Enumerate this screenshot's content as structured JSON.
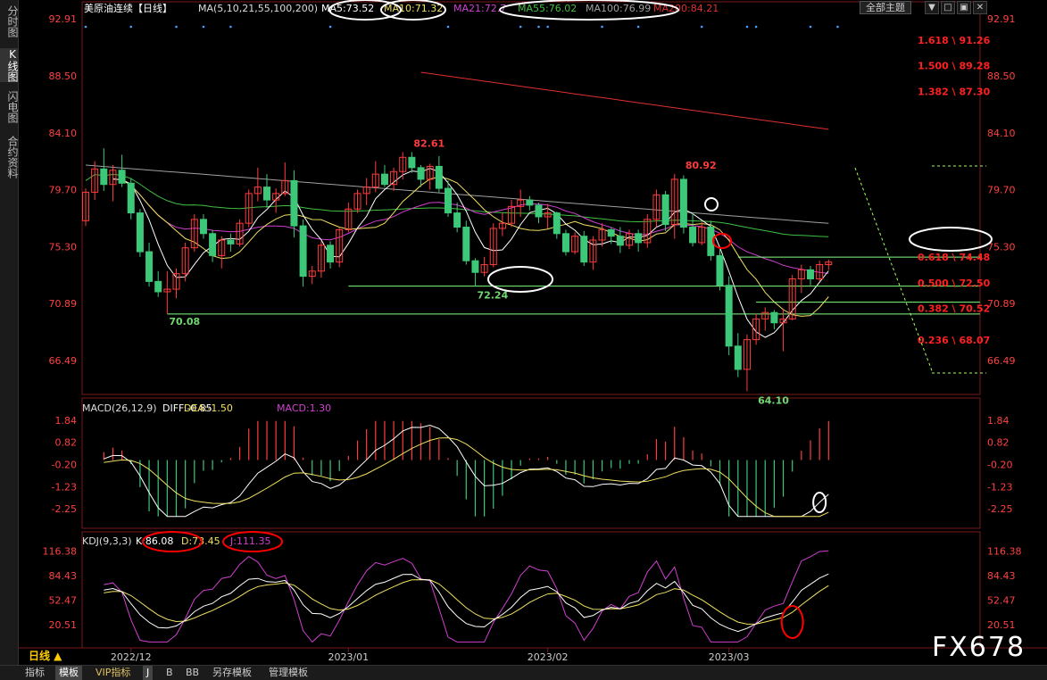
{
  "sidebar": {
    "tabs": [
      {
        "label": "分时图"
      },
      {
        "label": "K线图"
      },
      {
        "label": "闪电图"
      },
      {
        "label": "合约资料"
      }
    ]
  },
  "toolbar": {
    "theme_label": "全部主题",
    "period_label": "日线 ▲",
    "win_buttons": [
      "▼",
      "□",
      "▣",
      "✕"
    ]
  },
  "bottom_tabs": [
    {
      "label": "指标",
      "active": false
    },
    {
      "label": "模板",
      "active": true
    },
    {
      "label": "VIP指标",
      "active": false
    },
    {
      "label": "J",
      "active": false
    },
    {
      "label": "B",
      "active": false
    },
    {
      "label": "BB",
      "active": false
    },
    {
      "label": "另存模板",
      "active": false
    },
    {
      "label": "管理模板",
      "active": false
    }
  ],
  "watermark": "FX678",
  "colors": {
    "up": "#ff3c3c",
    "down": "#3cc878",
    "ma5": "#ffffff",
    "ma10": "#f0e060",
    "ma21": "#d040d0",
    "ma55": "#40c040",
    "ma100": "#a0a0a0",
    "ma200": "#e03030",
    "fib": "#ff2020",
    "support": "#80ff80",
    "axis": "#ff4040",
    "annot_white": "#ffffff",
    "annot_red": "#ff0000"
  },
  "chart_data": [
    {
      "type": "candlestick",
      "title": "美原油连续【日线】",
      "legend": {
        "ma_label": "MA(5,10,21,55,100,200)",
        "items": [
          {
            "name": "MA5",
            "text": "MA5:73.52",
            "color": "#ffffff"
          },
          {
            "name": "MA10",
            "text": "MA10:71.32",
            "color": "#f0e060"
          },
          {
            "name": "MA21",
            "text": "MA21:72.7",
            "color": "#d040d0"
          },
          {
            "name": "MA55",
            "text": "MA55:76.02",
            "color": "#40c040"
          },
          {
            "name": "MA100",
            "text": "MA100:76.99",
            "color": "#a0a0a0"
          },
          {
            "name": "MA200",
            "text": "MA200:84.21",
            "color": "#e03030"
          }
        ]
      },
      "y_ticks": [
        "92.91",
        "88.50",
        "84.10",
        "79.70",
        "75.30",
        "70.89",
        "66.49"
      ],
      "ylim": [
        64.0,
        93.4
      ],
      "x_ticks": [
        {
          "label": "2022/12",
          "index": 5
        },
        {
          "label": "2023/01",
          "index": 29
        },
        {
          "label": "2023/02",
          "index": 51
        },
        {
          "label": "2023/03",
          "index": 71
        }
      ],
      "candles": [
        [
          77.3,
          79.8,
          76.9,
          79.5
        ],
        [
          79.5,
          81.9,
          78.9,
          81.3
        ],
        [
          81.3,
          82.9,
          79.6,
          80.1
        ],
        [
          80.1,
          81.6,
          78.8,
          81.2
        ],
        [
          81.2,
          82.4,
          79.9,
          80.2
        ],
        [
          80.2,
          80.6,
          77.4,
          77.9
        ],
        [
          77.9,
          78.2,
          74.5,
          74.9
        ],
        [
          74.9,
          75.6,
          72.2,
          72.6
        ],
        [
          72.6,
          73.4,
          71.4,
          71.8
        ],
        [
          71.8,
          73.4,
          70.1,
          72.0
        ],
        [
          72.0,
          73.6,
          71.3,
          73.2
        ],
        [
          73.2,
          75.6,
          72.6,
          75.2
        ],
        [
          75.2,
          77.8,
          74.9,
          77.4
        ],
        [
          77.4,
          77.8,
          75.9,
          76.3
        ],
        [
          76.3,
          76.6,
          74.1,
          74.6
        ],
        [
          74.6,
          76.1,
          73.6,
          75.8
        ],
        [
          75.8,
          76.3,
          74.9,
          75.5
        ],
        [
          75.5,
          77.4,
          75.3,
          77.1
        ],
        [
          77.1,
          79.7,
          76.8,
          79.4
        ],
        [
          79.4,
          81.4,
          78.8,
          79.9
        ],
        [
          79.9,
          80.9,
          78.3,
          78.9
        ],
        [
          78.9,
          79.8,
          77.9,
          79.4
        ],
        [
          79.4,
          81.8,
          79.2,
          80.4
        ],
        [
          80.4,
          81.2,
          76.0,
          76.9
        ],
        [
          76.9,
          77.4,
          72.2,
          73.0
        ],
        [
          73.0,
          73.8,
          72.4,
          73.4
        ],
        [
          73.4,
          75.7,
          72.9,
          75.4
        ],
        [
          75.4,
          75.7,
          73.6,
          74.1
        ],
        [
          74.1,
          76.8,
          73.7,
          76.6
        ],
        [
          76.6,
          78.7,
          76.4,
          78.2
        ],
        [
          78.2,
          79.7,
          77.9,
          79.4
        ],
        [
          79.4,
          80.6,
          78.5,
          79.9
        ],
        [
          79.9,
          81.9,
          79.5,
          80.9
        ],
        [
          80.9,
          81.6,
          79.9,
          80.1
        ],
        [
          80.1,
          81.4,
          79.6,
          81.1
        ],
        [
          81.1,
          82.6,
          80.5,
          82.2
        ],
        [
          82.2,
          82.6,
          81.0,
          81.4
        ],
        [
          81.4,
          81.6,
          79.9,
          80.5
        ],
        [
          80.5,
          81.7,
          79.7,
          81.5
        ],
        [
          81.5,
          82.3,
          79.5,
          79.8
        ],
        [
          79.8,
          80.4,
          77.6,
          77.9
        ],
        [
          77.9,
          78.7,
          76.4,
          76.8
        ],
        [
          76.8,
          77.3,
          73.9,
          74.2
        ],
        [
          74.2,
          74.4,
          72.2,
          73.3
        ],
        [
          73.3,
          74.5,
          73.0,
          73.9
        ],
        [
          73.9,
          77.1,
          73.7,
          76.7
        ],
        [
          76.7,
          77.9,
          76.1,
          77.1
        ],
        [
          77.1,
          78.9,
          76.8,
          78.4
        ],
        [
          78.4,
          79.7,
          77.6,
          78.9
        ],
        [
          78.9,
          79.2,
          78.1,
          78.5
        ],
        [
          78.5,
          78.7,
          77.1,
          77.6
        ],
        [
          77.6,
          78.6,
          76.7,
          77.9
        ],
        [
          77.9,
          78.0,
          75.9,
          76.3
        ],
        [
          76.3,
          76.6,
          74.6,
          74.9
        ],
        [
          74.9,
          76.4,
          74.7,
          76.1
        ],
        [
          76.1,
          76.5,
          73.8,
          74.1
        ],
        [
          74.1,
          76.1,
          73.5,
          75.8
        ],
        [
          75.8,
          77.1,
          75.3,
          76.6
        ],
        [
          76.6,
          76.8,
          75.5,
          76.1
        ],
        [
          76.1,
          76.8,
          74.8,
          75.4
        ],
        [
          75.4,
          76.6,
          75.1,
          76.3
        ],
        [
          76.3,
          76.6,
          74.9,
          75.6
        ],
        [
          75.6,
          77.8,
          75.2,
          77.4
        ],
        [
          77.4,
          79.7,
          76.8,
          79.3
        ],
        [
          79.3,
          79.6,
          76.5,
          77.0
        ],
        [
          77.0,
          80.9,
          75.9,
          80.5
        ],
        [
          80.5,
          80.8,
          76.3,
          76.8
        ],
        [
          76.8,
          77.9,
          75.3,
          75.6
        ],
        [
          75.6,
          77.2,
          75.4,
          76.8
        ],
        [
          76.8,
          77.3,
          74.2,
          74.6
        ],
        [
          74.6,
          75.3,
          71.9,
          72.3
        ],
        [
          72.3,
          73.0,
          66.9,
          67.6
        ],
        [
          67.6,
          68.6,
          65.2,
          65.8
        ],
        [
          65.8,
          68.5,
          64.1,
          68.1
        ],
        [
          68.1,
          70.1,
          67.7,
          69.7
        ],
        [
          69.7,
          70.6,
          68.8,
          70.2
        ],
        [
          70.2,
          70.4,
          68.9,
          69.4
        ],
        [
          69.4,
          70.5,
          67.2,
          69.7
        ],
        [
          69.7,
          73.1,
          69.6,
          72.8
        ],
        [
          72.8,
          73.9,
          71.7,
          73.5
        ],
        [
          73.5,
          73.8,
          72.3,
          72.8
        ],
        [
          72.8,
          74.2,
          72.6,
          73.9
        ],
        [
          73.9,
          74.3,
          73.5,
          74.1
        ]
      ],
      "annotations": {
        "high1": "82.61",
        "high2": "80.92",
        "low1": "70.08",
        "low2": "72.24",
        "low3": "64.10"
      },
      "support_lines": [
        {
          "value": 74.48,
          "from": 72
        },
        {
          "value": 72.24,
          "from": 29
        },
        {
          "value": 71.0,
          "from": 74
        },
        {
          "value": 70.08,
          "from": 9
        }
      ],
      "fib_levels": [
        {
          "label": "1.618 \\ 91.26",
          "value": 91.26
        },
        {
          "label": "1.500 \\ 89.28",
          "value": 89.28
        },
        {
          "label": "1.382 \\ 87.30",
          "value": 87.3
        },
        {
          "label": "0.618 \\ 74.48",
          "value": 74.48
        },
        {
          "label": "0.500 \\ 72.50",
          "value": 72.5
        },
        {
          "label": "0.382 \\ 70.52",
          "value": 70.52
        },
        {
          "label": "0.236 \\ 68.07",
          "value": 68.07
        }
      ]
    },
    {
      "type": "bar",
      "title": "MACD(26,12,9)",
      "legend": [
        {
          "name": "DIFF",
          "text": "DIFF:-0.85"
        },
        {
          "name": "DEA",
          "text": "DEA:-1.50"
        },
        {
          "name": "MACD",
          "text": "MACD:1.30"
        }
      ],
      "y_ticks": [
        "1.84",
        "0.82",
        "-0.20",
        "-1.23",
        "-2.25"
      ],
      "ylim": [
        -2.9,
        2.2
      ]
    },
    {
      "type": "line",
      "title": "KDJ(9,3,3)",
      "legend": [
        {
          "name": "K",
          "text": "K:86.08"
        },
        {
          "name": "D",
          "text": "D:73.45"
        },
        {
          "name": "J",
          "text": "J:111.35"
        }
      ],
      "y_ticks": [
        "116.38",
        "84.43",
        "52.47",
        "20.51"
      ],
      "ylim": [
        -5,
        125
      ]
    }
  ]
}
